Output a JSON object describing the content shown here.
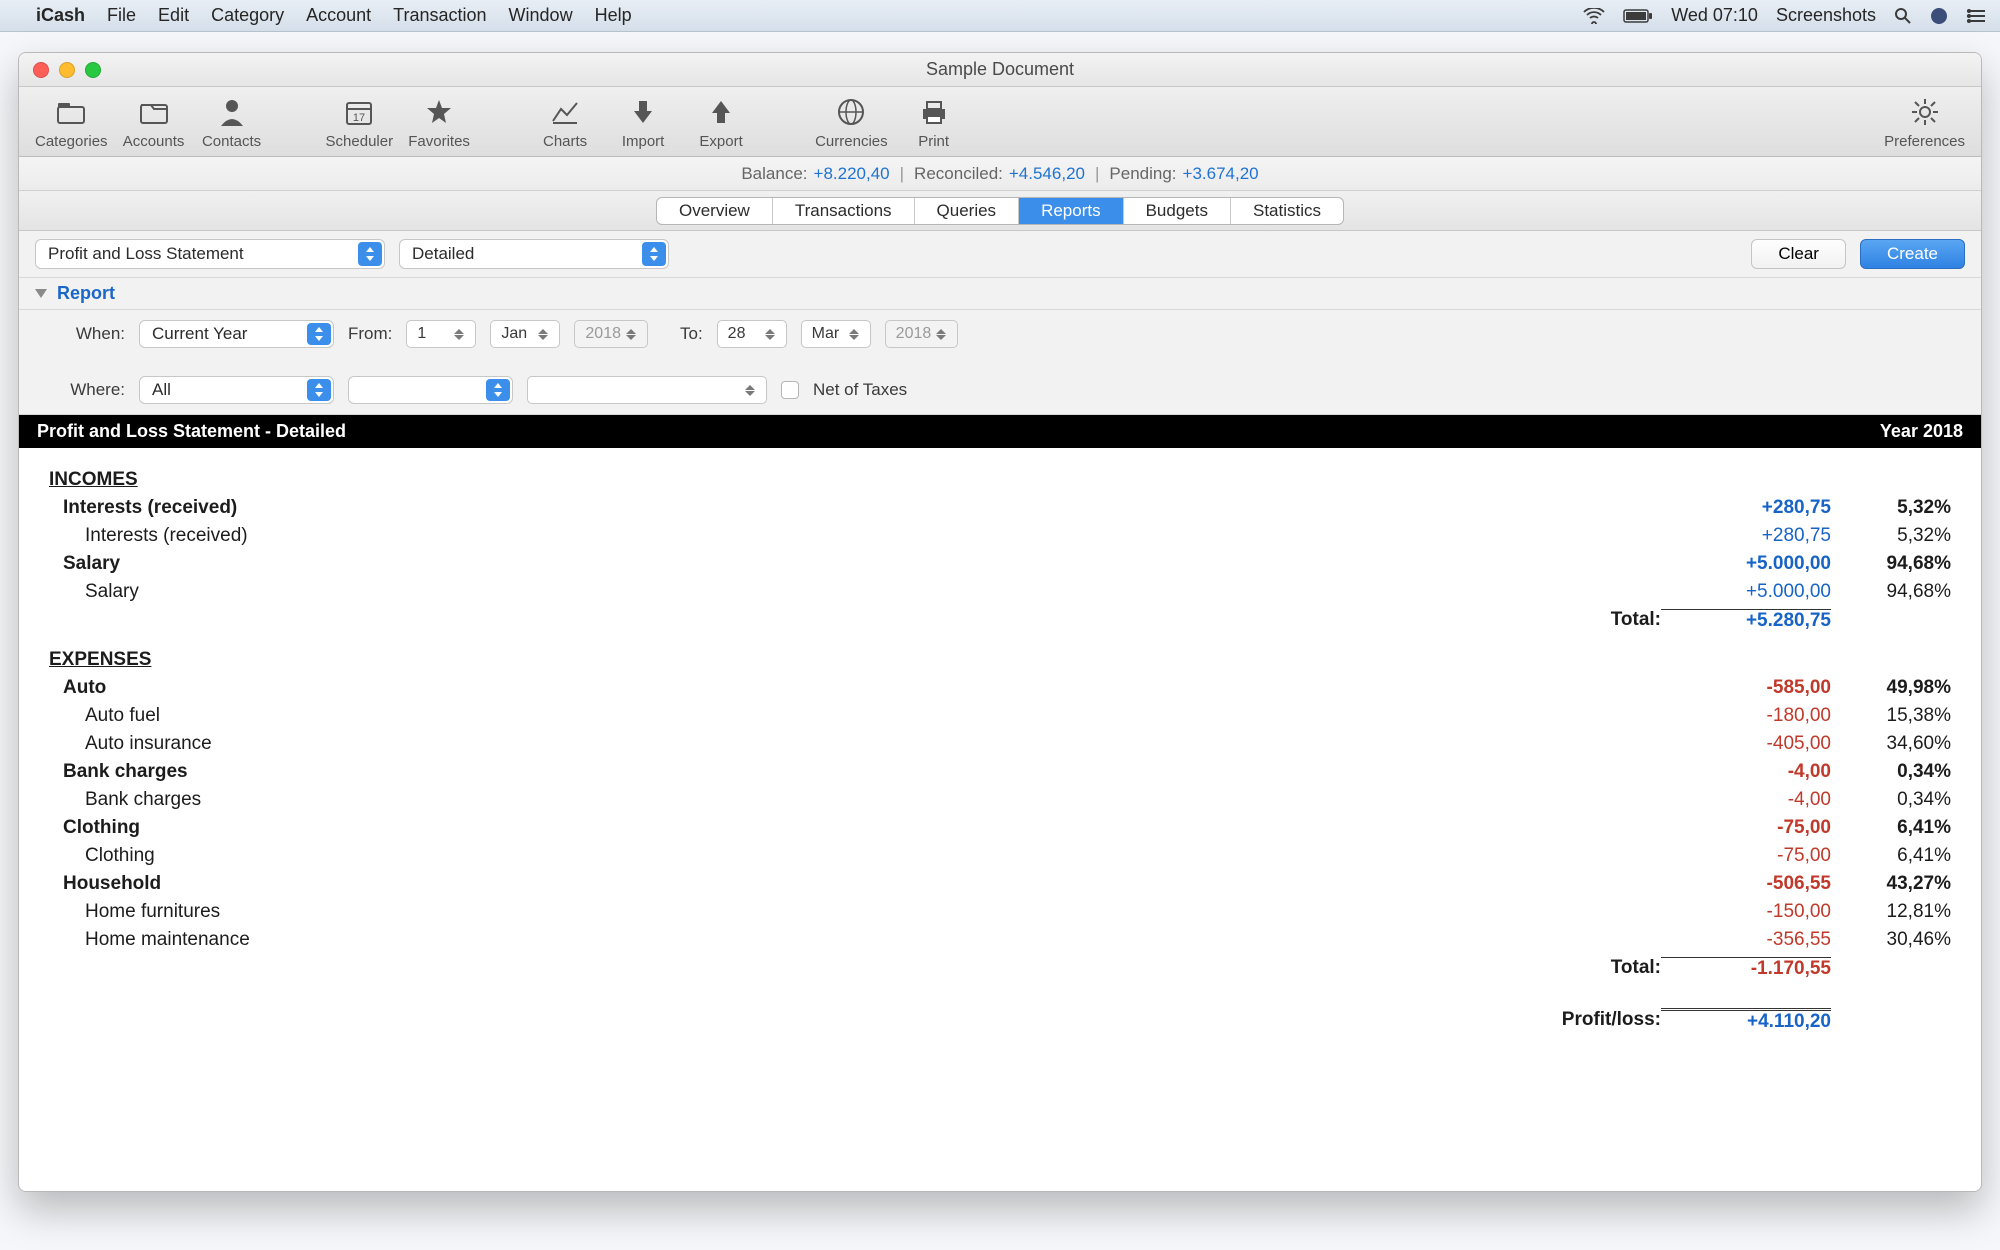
{
  "menubar": {
    "app": "iCash",
    "items": [
      "File",
      "Edit",
      "Category",
      "Account",
      "Transaction",
      "Window",
      "Help"
    ],
    "time": "Wed 07:10",
    "right_label": "Screenshots"
  },
  "window": {
    "title": "Sample Document"
  },
  "toolbar": {
    "categories": "Categories",
    "accounts": "Accounts",
    "contacts": "Contacts",
    "scheduler": "Scheduler",
    "favorites": "Favorites",
    "charts": "Charts",
    "import": "Import",
    "export": "Export",
    "currencies": "Currencies",
    "print": "Print",
    "preferences": "Preferences"
  },
  "info": {
    "balance_label": "Balance:",
    "balance_value": "+8.220,40",
    "reconciled_label": "Reconciled:",
    "reconciled_value": "+4.546,20",
    "pending_label": "Pending:",
    "pending_value": "+3.674,20"
  },
  "tabs": [
    "Overview",
    "Transactions",
    "Queries",
    "Reports",
    "Budgets",
    "Statistics"
  ],
  "tabs_active": "Reports",
  "ctrl": {
    "report_type": "Profit and Loss Statement",
    "detail": "Detailed",
    "clear": "Clear",
    "create": "Create",
    "section": "Report",
    "when_label": "When:",
    "when_value": "Current Year",
    "from_label": "From:",
    "from_day": "1",
    "from_month": "Jan",
    "from_year": "2018",
    "to_label": "To:",
    "to_day": "28",
    "to_month": "Mar",
    "to_year": "2018",
    "where_label": "Where:",
    "where_value": "All",
    "net_label": "Net of Taxes"
  },
  "report": {
    "title": "Profit and Loss Statement - Detailed",
    "period": "Year 2018",
    "incomes": {
      "heading": "INCOMES",
      "interests": {
        "label": "Interests (received)",
        "amount": "+280,75",
        "pct": "5,32%",
        "rows": [
          {
            "label": "Interests (received)",
            "amount": "+280,75",
            "pct": "5,32%"
          }
        ]
      },
      "salary": {
        "label": "Salary",
        "amount": "+5.000,00",
        "pct": "94,68%",
        "rows": [
          {
            "label": "Salary",
            "amount": "+5.000,00",
            "pct": "94,68%"
          }
        ]
      },
      "total_label": "Total:",
      "total": "+5.280,75"
    },
    "expenses": {
      "heading": "EXPENSES",
      "auto": {
        "label": "Auto",
        "amount": "-585,00",
        "pct": "49,98%",
        "rows": [
          {
            "label": "Auto fuel",
            "amount": "-180,00",
            "pct": "15,38%"
          },
          {
            "label": "Auto insurance",
            "amount": "-405,00",
            "pct": "34,60%"
          }
        ]
      },
      "bank": {
        "label": "Bank charges",
        "amount": "-4,00",
        "pct": "0,34%",
        "rows": [
          {
            "label": "Bank charges",
            "amount": "-4,00",
            "pct": "0,34%"
          }
        ]
      },
      "clothing": {
        "label": "Clothing",
        "amount": "-75,00",
        "pct": "6,41%",
        "rows": [
          {
            "label": "Clothing",
            "amount": "-75,00",
            "pct": "6,41%"
          }
        ]
      },
      "household": {
        "label": "Household",
        "amount": "-506,55",
        "pct": "43,27%",
        "rows": [
          {
            "label": "Home furnitures",
            "amount": "-150,00",
            "pct": "12,81%"
          },
          {
            "label": "Home maintenance",
            "amount": "-356,55",
            "pct": "30,46%"
          }
        ]
      },
      "total_label": "Total:",
      "total": "-1.170,55"
    },
    "pl_label": "Profit/loss:",
    "pl_value": "+4.110,20"
  }
}
